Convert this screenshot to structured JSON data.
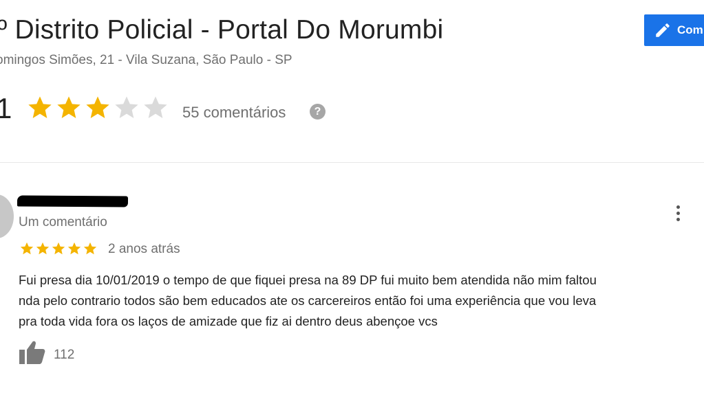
{
  "place": {
    "title": "º Distrito Policial - Portal Do Morumbi",
    "address": "omingos Simões, 21 - Vila Suzana, São Paulo - SP"
  },
  "header": {
    "comment_button_label": "Com"
  },
  "rating": {
    "value": "1",
    "stars_filled": 3,
    "stars_total": 5,
    "review_count": "55 comentários",
    "help_icon": "?"
  },
  "review": {
    "reviewer_meta": "Um comentário",
    "stars_filled": 5,
    "date": "2 anos atrás",
    "text_lines": [
      "Fui presa dia 10/01/2019 o tempo de que fiquei presa na 89 DP fui muito bem atendida não mim faltou",
      "nda pelo contrario todos são bem educados ate os carcereiros então foi uma experiência que vou leva",
      "pra toda vida fora os laços de amizade que fiz ai dentro deus abençoe vcs"
    ],
    "like_count": "112"
  },
  "icons": {
    "pencil": "pencil-icon",
    "star": "star-icon",
    "help": "help-icon",
    "menu": "more-vert-icon",
    "like": "thumbs-up-icon"
  },
  "colors": {
    "accent": "#1a73e8",
    "star_filled": "#f4b400",
    "star_empty": "#dadada",
    "muted_text": "#6f6f6f"
  }
}
